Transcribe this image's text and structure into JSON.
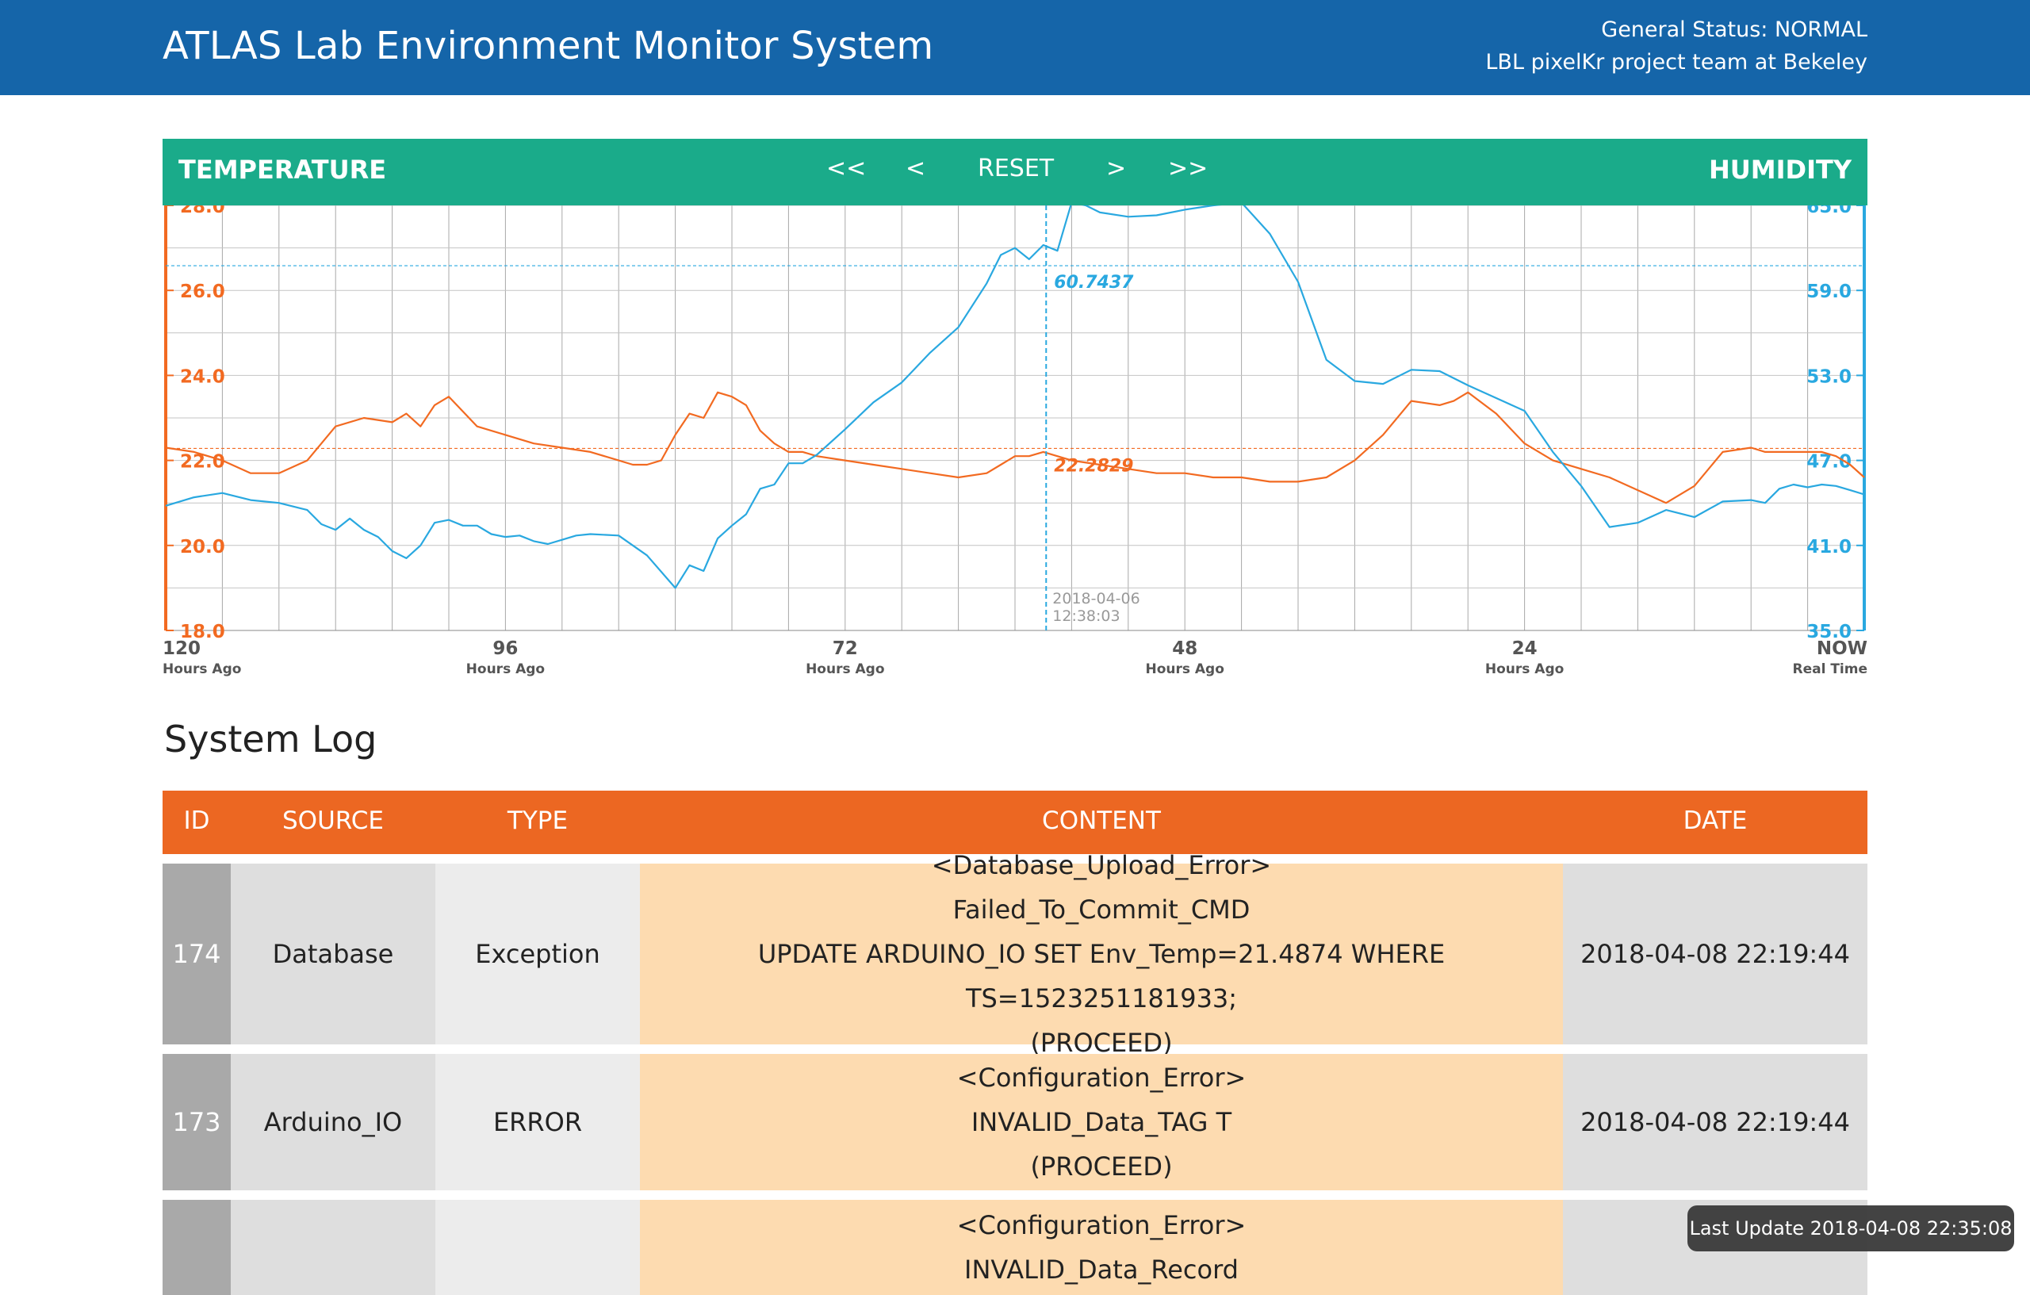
{
  "header": {
    "title": "ATLAS Lab Environment Monitor System",
    "status": "General Status: NORMAL",
    "team": "LBL pixelKr project team at Bekeley"
  },
  "chart_header": {
    "left_label": "TEMPERATURE",
    "right_label": "HUMIDITY",
    "nav": {
      "first": "<<",
      "prev": "<",
      "reset": "RESET",
      "next": ">",
      "last": ">>"
    }
  },
  "chart_data": {
    "type": "line",
    "x_unit": "hours ago",
    "xlim": [
      120,
      0
    ],
    "x_ticks": [
      {
        "value": 120,
        "label": "120",
        "sub": "Hours Ago"
      },
      {
        "value": 96,
        "label": "96",
        "sub": "Hours Ago"
      },
      {
        "value": 72,
        "label": "72",
        "sub": "Hours Ago"
      },
      {
        "value": 48,
        "label": "48",
        "sub": "Hours Ago"
      },
      {
        "value": 24,
        "label": "24",
        "sub": "Hours Ago"
      },
      {
        "value": 0,
        "label": "NOW",
        "sub": "Real Time"
      }
    ],
    "y_left": {
      "label": "TEMPERATURE",
      "ylim": [
        18,
        28
      ],
      "ticks": [
        "28.0",
        "26.0",
        "24.0",
        "22.0",
        "20.0",
        "18.0"
      ],
      "color": "#f26a21"
    },
    "y_right": {
      "label": "HUMIDITY",
      "ylim": [
        35,
        65
      ],
      "ticks": [
        "65.0",
        "59.0",
        "53.0",
        "47.0",
        "41.0",
        "35.0"
      ],
      "color": "#29a8e0"
    },
    "grid": true,
    "series": [
      {
        "name": "TEMPERATURE",
        "axis": "left",
        "color": "#f26a21",
        "x": [
          120,
          118,
          116,
          114,
          112,
          110,
          108,
          106,
          104,
          103,
          102,
          101,
          100,
          98,
          96,
          94,
          92,
          90,
          88,
          87,
          86,
          85,
          84,
          83,
          82,
          81,
          80,
          79,
          78,
          77,
          76,
          75,
          74,
          72,
          70,
          68,
          66,
          64,
          62,
          61,
          60,
          59,
          58,
          56,
          54,
          52,
          50,
          48,
          46,
          44,
          42,
          40,
          38,
          36,
          34,
          32,
          30,
          29,
          28,
          26,
          24,
          22,
          20,
          18,
          16,
          14,
          12,
          10,
          8,
          7,
          6,
          5,
          4,
          3,
          2,
          1,
          0
        ],
        "y": [
          22.3,
          22.2,
          22.0,
          21.7,
          21.7,
          22.0,
          22.8,
          23.0,
          22.9,
          23.1,
          22.8,
          23.3,
          23.5,
          22.8,
          22.6,
          22.4,
          22.3,
          22.2,
          22.0,
          21.9,
          21.9,
          22.0,
          22.6,
          23.1,
          23.0,
          23.6,
          23.5,
          23.3,
          22.7,
          22.4,
          22.2,
          22.2,
          22.1,
          22.0,
          21.9,
          21.8,
          21.7,
          21.6,
          21.7,
          21.9,
          22.1,
          22.1,
          22.2,
          22.0,
          21.9,
          21.8,
          21.7,
          21.7,
          21.6,
          21.6,
          21.5,
          21.5,
          21.6,
          22.0,
          22.6,
          23.4,
          23.3,
          23.4,
          23.6,
          23.1,
          22.4,
          22.0,
          21.8,
          21.6,
          21.3,
          21.0,
          21.4,
          22.2,
          22.3,
          22.2,
          22.2,
          22.2,
          22.2,
          22.2,
          22.1,
          21.9,
          21.6
        ]
      },
      {
        "name": "HUMIDITY",
        "axis": "right",
        "color": "#29a8e0",
        "x": [
          120,
          118,
          116,
          114,
          112,
          110,
          109,
          108,
          107,
          106,
          105,
          104,
          103,
          102,
          101,
          100,
          99,
          98,
          97,
          96,
          95,
          94,
          93,
          92,
          91,
          90,
          88,
          86,
          84,
          83,
          82,
          81,
          80,
          79,
          78,
          77,
          76,
          75,
          74,
          72,
          70,
          68,
          66,
          64,
          62,
          61,
          60,
          59,
          58,
          57,
          56,
          55,
          54,
          52,
          50,
          48,
          46,
          44,
          42,
          40,
          38,
          36,
          34,
          32,
          30,
          28,
          26,
          24,
          22,
          20,
          18,
          16,
          14,
          12,
          10,
          8,
          7,
          6,
          5,
          4,
          3,
          2,
          1,
          0
        ],
        "y": [
          43.8,
          44.4,
          44.7,
          44.2,
          44.0,
          43.5,
          42.5,
          42.1,
          42.9,
          42.1,
          41.6,
          40.6,
          40.1,
          41.0,
          42.6,
          42.8,
          42.4,
          42.4,
          41.8,
          41.6,
          41.7,
          41.3,
          41.1,
          41.4,
          41.7,
          41.8,
          41.7,
          40.3,
          38.0,
          39.6,
          39.2,
          41.5,
          42.4,
          43.2,
          45.0,
          45.3,
          46.8,
          46.8,
          47.4,
          49.2,
          51.1,
          52.5,
          54.6,
          56.4,
          59.5,
          61.5,
          62.0,
          61.2,
          62.2,
          61.8,
          65.2,
          65.0,
          64.5,
          64.2,
          64.3,
          64.7,
          65.0,
          65.2,
          63.0,
          59.6,
          54.1,
          52.6,
          52.4,
          53.4,
          53.3,
          52.3,
          51.4,
          50.5,
          47.6,
          45.2,
          42.3,
          42.6,
          43.5,
          43.0,
          44.1,
          44.2,
          44.0,
          45.0,
          45.3,
          45.1,
          45.3,
          45.2,
          44.9,
          44.6
        ]
      }
    ],
    "cursor": {
      "x": 57.8,
      "date": "2018-04-06",
      "time": "12:38:03",
      "temp_label": "22.2829",
      "humid_label": "60.7437",
      "temp_value": 22.2829,
      "humid_value": 60.7437
    }
  },
  "log": {
    "title": "System Log",
    "columns": [
      "ID",
      "SOURCE",
      "TYPE",
      "CONTENT",
      "DATE"
    ],
    "rows": [
      {
        "id": "174",
        "source": "Database",
        "type": "Exception",
        "content": [
          "<Database_Upload_Error>",
          "Failed_To_Commit_CMD",
          "UPDATE ARDUINO_IO SET Env_Temp=21.4874 WHERE TS=1523251181933;",
          "(PROCEED)"
        ],
        "date": "2018-04-08 22:19:44"
      },
      {
        "id": "173",
        "source": "Arduino_IO",
        "type": "ERROR",
        "content": [
          "<Configuration_Error>",
          "INVALID_Data_TAG T",
          "(PROCEED)"
        ],
        "date": "2018-04-08 22:19:44"
      },
      {
        "id": "",
        "source": "",
        "type": "",
        "content": [
          "<Configuration_Error>",
          "INVALID_Data_Record"
        ],
        "date": ""
      }
    ]
  },
  "toast": {
    "text": "Last Update 2018-04-08 22:35:08"
  }
}
